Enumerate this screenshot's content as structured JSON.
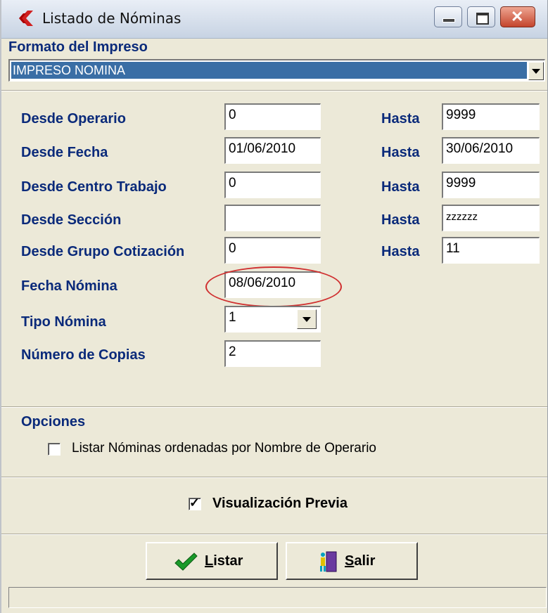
{
  "window": {
    "title": "Listado de Nóminas"
  },
  "formato": {
    "label": "Formato del Impreso",
    "selected": "IMPRESO NOMINA"
  },
  "fields": [
    {
      "label": "Desde Operario",
      "from": "0",
      "hasta_label": "Hasta",
      "to": "9999"
    },
    {
      "label": "Desde Fecha",
      "from": "01/06/2010",
      "hasta_label": "Hasta",
      "to": "30/06/2010"
    },
    {
      "label": "Desde Centro Trabajo",
      "from": "0",
      "hasta_label": "Hasta",
      "to": "9999"
    },
    {
      "label": "Desde Sección",
      "from": "",
      "hasta_label": "Hasta",
      "to": "zzzzzz"
    },
    {
      "label": "Desde Grupo Cotización",
      "from": "0",
      "hasta_label": "Hasta",
      "to": "11"
    }
  ],
  "fecha_nomina": {
    "label": "Fecha Nómina",
    "value": "08/06/2010"
  },
  "tipo_nomina": {
    "label": "Tipo Nómina",
    "value": "1"
  },
  "copias": {
    "label": "Número de Copias",
    "value": "2"
  },
  "opciones": {
    "label": "Opciones",
    "ordenar_label": "Listar Nóminas ordenadas por Nombre de Operario",
    "ordenar_checked": false
  },
  "visualizacion": {
    "label": "Visualización Previa",
    "checked": true
  },
  "buttons": {
    "listar": {
      "mnemonic": "L",
      "rest": "istar"
    },
    "salir": {
      "mnemonic": "S",
      "rest": "alir"
    }
  },
  "colors": {
    "label_blue": "#0a2a7a",
    "selection_blue": "#3a6ea5",
    "annotation_red": "#d03030",
    "check_green": "#1a9a2a"
  },
  "status": {
    "text": ""
  }
}
